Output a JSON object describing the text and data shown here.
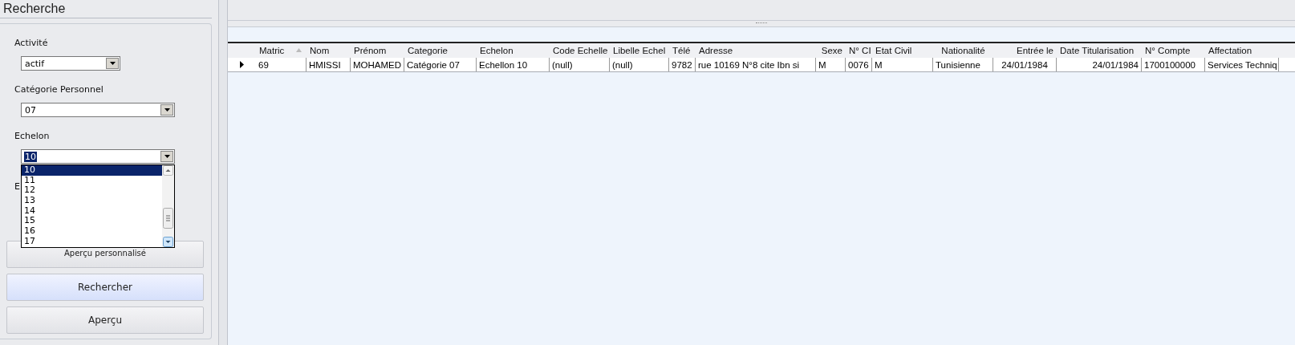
{
  "search_panel": {
    "title": "Recherche",
    "filters": [
      {
        "label": "Activité",
        "value": "actif",
        "open": false
      },
      {
        "label": "Catégorie Personnel",
        "value": "07",
        "open": false
      },
      {
        "label": "Echelon",
        "value": "10",
        "open": true,
        "options": [
          {
            "label": "10",
            "selected": true
          },
          {
            "label": "11",
            "selected": false
          },
          {
            "label": "12",
            "selected": false
          },
          {
            "label": "13",
            "selected": false
          },
          {
            "label": "14",
            "selected": false
          },
          {
            "label": "15",
            "selected": false
          },
          {
            "label": "16",
            "selected": false
          },
          {
            "label": "17",
            "selected": false
          }
        ]
      }
    ],
    "hidden_label": "E",
    "buttons": [
      {
        "label": "Aperçu personnalisé",
        "kind": "small"
      },
      {
        "label": "Rechercher",
        "kind": "primary"
      },
      {
        "label": "Aperçu",
        "kind": "normal"
      }
    ]
  },
  "grid": {
    "columns": [
      {
        "label": "Matric",
        "sorted": true
      },
      {
        "label": "Nom",
        "sorted": false
      },
      {
        "label": "Prénom",
        "sorted": false
      },
      {
        "label": "Categorie",
        "sorted": false
      },
      {
        "label": "Echelon",
        "sorted": false
      },
      {
        "label": "Code Echelle",
        "sorted": false
      },
      {
        "label": "Libelle Echel",
        "sorted": false
      },
      {
        "label": "Télé",
        "sorted": false
      },
      {
        "label": "Adresse",
        "sorted": false
      },
      {
        "label": "Sexe",
        "sorted": false
      },
      {
        "label": "N° CI",
        "sorted": false
      },
      {
        "label": "Etat Civil",
        "sorted": false
      },
      {
        "label": "Nationalité",
        "sorted": false
      },
      {
        "label": "Entrée le",
        "sorted": false
      },
      {
        "label": "Date Titularisation",
        "sorted": false
      },
      {
        "label": "N° Compte",
        "sorted": false
      },
      {
        "label": "Affectation",
        "sorted": false
      }
    ],
    "rows": [
      {
        "current": true,
        "cells": [
          "69",
          "HMISSI",
          "MOHAMED",
          "Catégorie 07",
          "Echellon 10",
          "(null)",
          "(null)",
          "9782",
          "rue 10169 N°8 cite Ibn si",
          "M",
          "0076",
          "M",
          "Tunisienne",
          "24/01/1984",
          "24/01/1984",
          "1700100000",
          "Services Techniq"
        ]
      }
    ]
  }
}
